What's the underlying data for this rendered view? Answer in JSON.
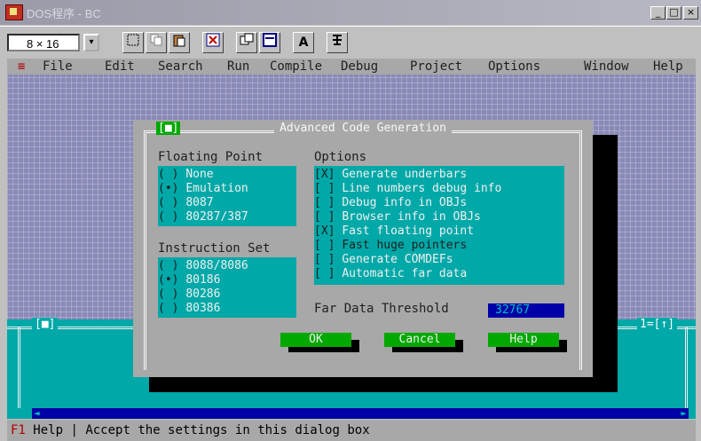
{
  "titlebar": {
    "title": "DOS程序 - BC",
    "minimize": "_",
    "maximize": "□",
    "close": "×"
  },
  "toolbar": {
    "font_select": "8 × 16",
    "dropdown": "▾",
    "font_button": "A"
  },
  "menubar": {
    "items": [
      "≡",
      "File",
      "Edit",
      "Search",
      "Run",
      "Compile",
      "Debug",
      "Project",
      "Options",
      "Window",
      "Help"
    ]
  },
  "dialog": {
    "title": "Advanced Code Generation",
    "close": "[■]",
    "floating_point": {
      "label": "Floating Point",
      "items": [
        {
          "mark": "( )",
          "label": "None"
        },
        {
          "mark": "(•)",
          "label": "Emulation"
        },
        {
          "mark": "( )",
          "label": "8087"
        },
        {
          "mark": "( )",
          "label": "80287/387"
        }
      ]
    },
    "instruction_set": {
      "label": "Instruction Set",
      "items": [
        {
          "mark": "( )",
          "label": "8088/8086"
        },
        {
          "mark": "(•)",
          "label": "80186"
        },
        {
          "mark": "( )",
          "label": "80286"
        },
        {
          "mark": "( )",
          "label": "80386"
        }
      ]
    },
    "options": {
      "label": "Options",
      "items": [
        {
          "mark": "[X]",
          "label": "Generate underbars"
        },
        {
          "mark": "[ ]",
          "label": "Line numbers debug info"
        },
        {
          "mark": "[ ]",
          "label": "Debug info in OBJs"
        },
        {
          "mark": "[ ]",
          "label": "Browser info in OBJs"
        },
        {
          "mark": "[X]",
          "label": "Fast floating point"
        },
        {
          "mark": "[ ]",
          "label": "Fast huge pointers"
        },
        {
          "mark": "[ ]",
          "label": "Generate COMDEFs"
        },
        {
          "mark": "[ ]",
          "label": "Automatic far data"
        }
      ]
    },
    "far_data_threshold": {
      "label": "Far Data Threshold",
      "value": "32767"
    },
    "buttons": {
      "ok": "OK",
      "cancel": "Cancel",
      "help": "Help"
    }
  },
  "edit_window": {
    "close": "[■]",
    "window_number": "1=[↑]",
    "scroll_left": "◄",
    "scroll_right": "►"
  },
  "statusbar": {
    "key": "F1",
    "key_label": "Help",
    "separator": "|",
    "message": "Accept the settings in this dialog box"
  }
}
